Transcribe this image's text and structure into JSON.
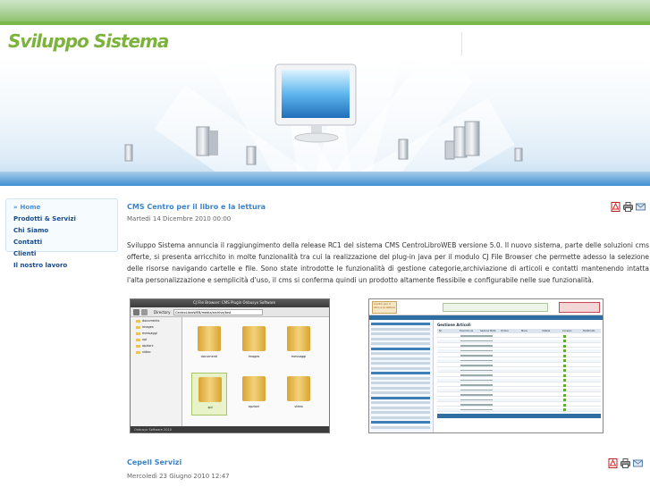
{
  "header": {
    "site_title": "Sviluppo Sistema"
  },
  "sidebar": {
    "items": [
      {
        "label": "Home",
        "active": true
      },
      {
        "label": "Prodotti & Servizi"
      },
      {
        "label": "Chi Siamo"
      },
      {
        "label": "Contatti"
      },
      {
        "label": "Clienti"
      },
      {
        "label": "Il nostro lavoro"
      }
    ]
  },
  "articles": [
    {
      "title": "CMS Centro per il libro e la lettura",
      "date": "Martedì 14 Dicembre 2010 00:00",
      "body": "Sviluppo Sistema  annuncia il raggiungimento della release RC1 del sistema CMS CentroLibroWEB versione 5.0. Il nuovo sistema, parte delle soluzioni cms offerte, si presenta arricchito in molte funzionalità tra cui la realizzazione del plug-in java per il modulo CJ File Browser che  permette adesso la selezione delle risorse navigando cartelle e file. Sono state introdotte le funzionalità di gestione categorie,archiviazione di articoli e contatti mantenendo intatta l'alta personalizzazione e semplicità d'uso, il cms si conferma quindi un prodotto altamente flessibile e configurabile nelle sue funzionalità."
    },
    {
      "title": "Cepell Servizi",
      "date": "Mercoledì 23 Giugno 2010 12:47"
    }
  ],
  "article_icons": [
    "pdf-icon",
    "print-icon",
    "email-icon"
  ],
  "screenshot1": {
    "window_title": "CJ File Browser: CMS Plugin Onbusyx Software",
    "address_label": "Directory",
    "address_value": "CentroLibroWEB/media/archive/test",
    "tree": [
      "documents",
      "images",
      "messaggi",
      "xpl",
      "opzioni",
      "video"
    ],
    "folders": [
      "documenti",
      "images",
      "messaggi",
      "xpl",
      "opzioni",
      "video"
    ],
    "footer_text": "Onbusyx Software 2010"
  },
  "screenshot2": {
    "header_text": "Centro per il libro e la lettura",
    "section_title": "Gestione Articoli",
    "columns": [
      "Nr.",
      "Descrizione",
      "Sezione Meta",
      "Ordine",
      "Menu",
      "Visibile",
      "Accesso",
      "Pubblicato"
    ]
  },
  "colors": {
    "accent_green": "#7cb33a",
    "nav_blue": "#174a8b",
    "link_blue": "#3b82c9",
    "banner_blue": "#3f8fd0"
  }
}
